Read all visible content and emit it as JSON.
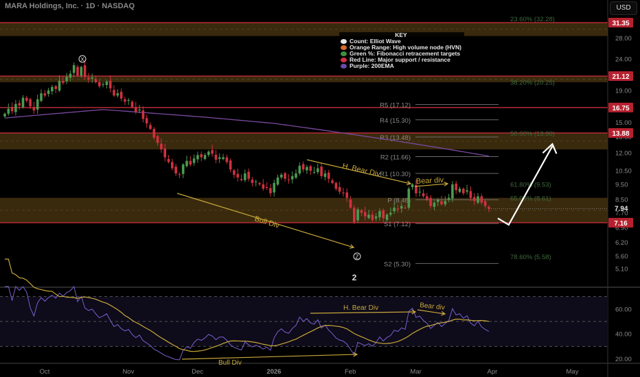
{
  "header": {
    "title": "MARA Holdings, Inc. · 1D · NASDAQ",
    "currency": "USD"
  },
  "key": {
    "title": "KEY",
    "items": [
      {
        "label": "Count: Elliot Wave",
        "color": "#e6e6e6"
      },
      {
        "label": "Orange Range: High volume node (HVN)",
        "color": "#d9692b"
      },
      {
        "label": "Green %: Fibonacci retracement targets",
        "color": "#3f8f3f"
      },
      {
        "label": "Red Line: Major support / resistance",
        "color": "#d03040"
      },
      {
        "label": "Purple: 200EMA",
        "color": "#6b4aa8"
      }
    ]
  },
  "chart_data": {
    "type": "candlestick",
    "scale": "log",
    "ylim": [
      5.0,
      34.0
    ],
    "x_ticks": [
      {
        "label": "Oct",
        "index": 10
      },
      {
        "label": "Nov",
        "index": 33
      },
      {
        "label": "Dec",
        "index": 52
      },
      {
        "label": "2026",
        "index": 73
      },
      {
        "label": "Feb",
        "index": 94
      },
      {
        "label": "Mar",
        "index": 112
      },
      {
        "label": "Apr",
        "index": 133
      },
      {
        "label": "May",
        "index": 155
      }
    ],
    "y_ticks": [
      "28.00",
      "24.00",
      "19.00",
      "15.00",
      "13.50",
      "12.00",
      "10.50",
      "9.50",
      "8.50",
      "7.70",
      "6.90",
      "6.20",
      "5.60",
      "5.10"
    ],
    "closes": [
      16.0,
      16.6,
      16.3,
      17.2,
      17.0,
      18.0,
      17.6,
      16.9,
      16.4,
      17.8,
      18.6,
      18.3,
      19.0,
      19.5,
      19.2,
      20.4,
      20.1,
      21.0,
      21.5,
      22.9,
      21.2,
      22.6,
      21.0,
      20.6,
      20.9,
      20.2,
      19.6,
      19.9,
      20.3,
      19.3,
      18.3,
      18.6,
      17.9,
      17.5,
      17.7,
      16.8,
      16.2,
      16.5,
      15.4,
      14.9,
      14.3,
      13.4,
      12.9,
      12.3,
      11.6,
      11.2,
      10.7,
      10.3,
      10.2,
      11.0,
      11.3,
      11.0,
      11.5,
      11.8,
      11.6,
      11.8,
      12.1,
      11.9,
      11.4,
      11.6,
      11.6,
      11.2,
      10.6,
      10.2,
      10.0,
      9.8,
      10.3,
      9.9,
      9.6,
      9.7,
      9.5,
      9.2,
      9.3,
      8.9,
      9.6,
      10.0,
      10.2,
      9.9,
      9.8,
      10.1,
      10.3,
      10.9,
      10.6,
      10.8,
      10.5,
      10.4,
      10.7,
      10.1,
      10.3,
      9.9,
      9.6,
      9.2,
      9.0,
      8.9,
      8.6,
      8.0,
      7.2,
      7.9,
      7.7,
      7.5,
      7.6,
      7.3,
      7.5,
      7.8,
      7.4,
      7.6,
      7.7,
      8.0,
      7.9,
      8.1,
      8.0,
      9.2,
      9.5,
      8.9,
      9.0,
      8.7,
      8.5,
      8.1,
      8.3,
      8.5,
      8.2,
      8.4,
      8.6,
      9.5,
      9.1,
      9.2,
      8.9,
      9.1,
      8.6,
      8.4,
      8.7,
      8.3,
      8.1,
      7.94
    ],
    "ema200": [
      [
        0,
        15.5
      ],
      [
        27,
        16.5
      ],
      [
        55,
        15.6
      ],
      [
        74,
        14.9
      ],
      [
        111,
        12.9
      ],
      [
        133,
        11.7
      ]
    ],
    "current_price": "7.94",
    "resistance_lines": [
      "31.35",
      "21.12",
      "16.75",
      "13.88",
      "7.16"
    ],
    "hvn_ranges": [
      [
        28.4,
        31.35
      ],
      [
        20.2,
        21.12
      ],
      [
        12.3,
        13.88
      ],
      [
        7.16,
        8.6
      ]
    ],
    "pivots": [
      {
        "label": "R5 (17.12)",
        "value": 17.12
      },
      {
        "label": "R4 (15.30)",
        "value": 15.3
      },
      {
        "label": "R3 (13.48)",
        "value": 13.48
      },
      {
        "label": "R2 (11.66)",
        "value": 11.66
      },
      {
        "label": "R1 (10.30)",
        "value": 10.3
      },
      {
        "label": "P (8.48)",
        "value": 8.48
      },
      {
        "label": "S1 (7.12)",
        "value": 7.12
      },
      {
        "label": "S2 (5.30)",
        "value": 5.3
      }
    ],
    "fibs": [
      {
        "label": "23.60% (32.28)",
        "value": 32.28
      },
      {
        "label": "38.20% (20.25)",
        "value": 20.25
      },
      {
        "label": "50.00% (13.90)",
        "value": 13.9
      },
      {
        "label": "61.80% (9.53)",
        "value": 9.53
      },
      {
        "label": "65.00% (8.61)",
        "value": 8.61
      },
      {
        "label": "78.60% (5.58)",
        "value": 5.58
      }
    ],
    "wave_labels": {
      "x": "X",
      "z": "Z",
      "two": "2"
    },
    "annotations": {
      "bull_div": "Bull Div",
      "h_bear_div": "H. Bear Div",
      "bear_div": "Bear div"
    },
    "projection": [
      [
        133,
        7.4
      ],
      [
        136,
        7.05
      ],
      [
        148,
        12.6
      ]
    ],
    "rsi": {
      "y_ticks": [
        "60.00",
        "40.00",
        "20.00"
      ],
      "levels": [
        70,
        50,
        30
      ],
      "annotations": {
        "bull_div": "Bull Div",
        "h_bear_div": "H. Bear Div",
        "bear_div": "Bear div"
      }
    }
  }
}
